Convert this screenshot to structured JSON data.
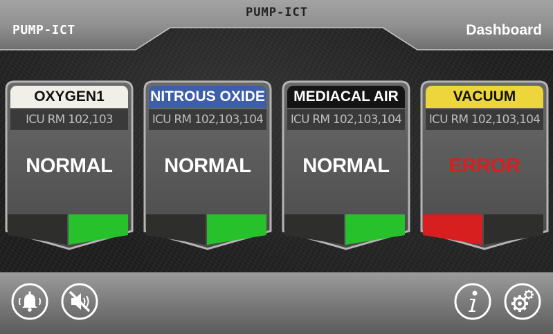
{
  "header": {
    "brand_center": "PUMP-ICT",
    "brand_left": "PUMP-ICT",
    "page_title": "Dashboard"
  },
  "cards": [
    {
      "title": "OXYGEN1",
      "location": "ICU RM 102,103",
      "status": "NORMAL",
      "title_bg": "#f1f0e8",
      "title_color": "#111111",
      "status_color": "#ffffff",
      "indicator_left": "#2e2f2d",
      "indicator_right": "#27c12b"
    },
    {
      "title": "NITROUS OXIDE",
      "location": "ICU RM 102,103,104",
      "status": "NORMAL",
      "title_bg": "#3d5ea8",
      "title_color": "#ffffff",
      "status_color": "#ffffff",
      "indicator_left": "#2e2f2d",
      "indicator_right": "#27c12b"
    },
    {
      "title": "MEDIACAL AIR",
      "location": "ICU RM 102,103,104",
      "status": "NORMAL",
      "title_bg": "#141414",
      "title_color": "#ffffff",
      "status_color": "#ffffff",
      "indicator_left": "#2e2f2d",
      "indicator_right": "#27c12b"
    },
    {
      "title": "VACUUM",
      "location": "ICU RM 102,103,104",
      "status": "ERROR",
      "title_bg": "#ecd63c",
      "title_color": "#111111",
      "status_color": "#d81f1f",
      "indicator_left": "#d81f1f",
      "indicator_right": "#2e2f2d"
    }
  ],
  "footer": {
    "alarm_icon": "alarm-bell-icon",
    "mute_icon": "speaker-mute-icon",
    "info_icon": "info-icon",
    "settings_icon": "gear-icon"
  }
}
